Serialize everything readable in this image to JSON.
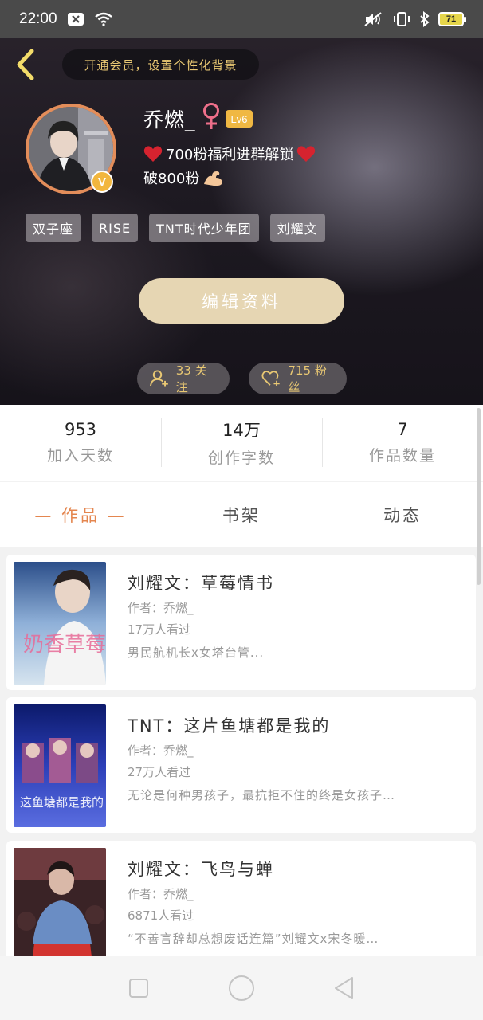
{
  "status_bar": {
    "time": "22:00",
    "battery": "71"
  },
  "header": {
    "vip_banner": "开通会员，设置个性化背景",
    "username": "乔燃_",
    "level": "Lv6",
    "verified_badge": "V",
    "bio_line1": "700粉福利进群解锁",
    "bio_line2": "破800粉",
    "tags": [
      "双子座",
      "RISE",
      "TNT时代少年团",
      "刘耀文"
    ],
    "edit_button": "编辑资料",
    "following": "33 关注",
    "fans": "715 粉丝",
    "colors": {
      "accent": "#e9c873",
      "avatar_ring": "#e38d5a",
      "edit_button": "#e6d6b3"
    }
  },
  "stats": [
    {
      "value": "953",
      "label": "加入天数"
    },
    {
      "value": "14万",
      "label": "创作字数"
    },
    {
      "value": "7",
      "label": "作品数量"
    }
  ],
  "tabs": [
    {
      "label": "— 作品 —",
      "active": true
    },
    {
      "label": "书架",
      "active": false
    },
    {
      "label": "动态",
      "active": false
    }
  ],
  "works": [
    {
      "title": "刘耀文：草莓情书",
      "author": "作者：乔燃_",
      "views": "17万人看过",
      "desc": "男民航机长x女塔台管...",
      "cover_text": "奶香草莓茶"
    },
    {
      "title": "TNT：这片鱼塘都是我的",
      "author": "作者：乔燃_",
      "views": "27万人看过",
      "desc": "无论是何种男孩子，最抗拒不住的终是女孩子…",
      "cover_text": "这鱼塘都是我的"
    },
    {
      "title": "刘耀文：飞鸟与蝉",
      "author": "作者：乔燃_",
      "views": "6871人看过",
      "desc": "“不善言辞却总想废话连篇”刘耀文x宋冬暖…",
      "cover_text": ""
    }
  ],
  "nav_bar": {
    "icons": [
      "square-icon",
      "circle-icon",
      "triangle-back-icon"
    ]
  }
}
